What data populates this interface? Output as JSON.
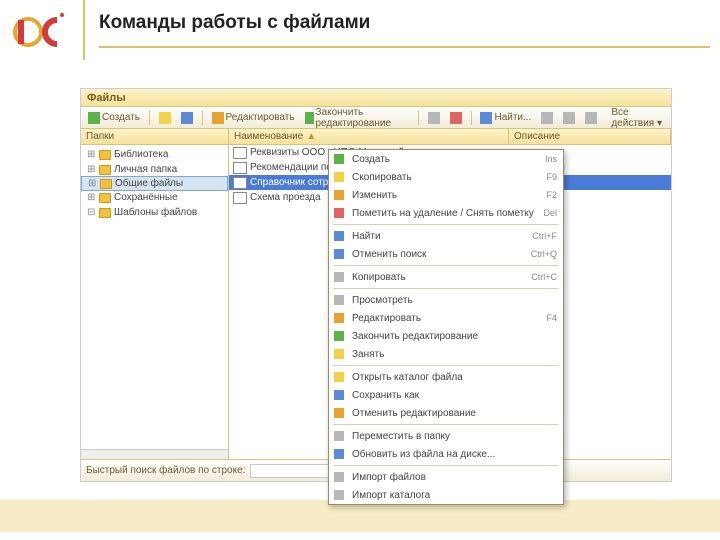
{
  "page_title": "Команды работы с файлами",
  "window_title": "Файлы",
  "toolbar": {
    "create": "Создать",
    "edit": "Редактировать",
    "finish_edit": "Закончить редактирование",
    "find_ellipsis": "Найти...",
    "all_actions": "Все действия ▾"
  },
  "tree": {
    "header": "Папки",
    "items": [
      "Библиотека",
      "Личная папка",
      "Общие файлы",
      "Сохранённые",
      "Шаблоны файлов"
    ]
  },
  "list": {
    "col_name": "Наименование",
    "col_desc": "Описание",
    "rows": [
      "Реквизиты ООО «НПО Меркурий»",
      "Рекомендации по организации дежурства на новогодние праздники",
      "Справочник сотрудников",
      "Схема проезда"
    ]
  },
  "footer": {
    "label": "Быстрый поиск файлов по строке:"
  },
  "context_menu": [
    {
      "icon": "create-icon",
      "label": "Создать",
      "shortcut": "Ins",
      "color": "c-green"
    },
    {
      "icon": "copy-icon",
      "label": "Скопировать",
      "shortcut": "F9",
      "color": "c-yel"
    },
    {
      "icon": "change-icon",
      "label": "Изменить",
      "shortcut": "F2",
      "color": "c-orange"
    },
    {
      "icon": "delete-icon",
      "label": "Пометить на удаление / Снять пометку",
      "shortcut": "Del",
      "color": "c-red"
    },
    {
      "sep": true
    },
    {
      "icon": "find-icon",
      "label": "Найти",
      "shortcut": "Ctrl+F",
      "color": "c-blue"
    },
    {
      "icon": "cancel-find-icon",
      "label": "Отменить поиск",
      "shortcut": "Ctrl+Q",
      "color": "c-blue"
    },
    {
      "sep": true
    },
    {
      "icon": "copy2-icon",
      "label": "Копировать",
      "shortcut": "Ctrl+C",
      "color": "c-grey"
    },
    {
      "sep": true
    },
    {
      "icon": "view-icon",
      "label": "Просмотреть",
      "shortcut": "",
      "color": "c-grey"
    },
    {
      "icon": "edit-icon",
      "label": "Редактировать",
      "shortcut": "F4",
      "color": "c-orange"
    },
    {
      "icon": "finish-edit-icon",
      "label": "Закончить редактирование",
      "shortcut": "",
      "color": "c-green"
    },
    {
      "icon": "take-icon",
      "label": "Занять",
      "shortcut": "",
      "color": "c-yel"
    },
    {
      "sep": true
    },
    {
      "icon": "open-dir-icon",
      "label": "Открыть каталог файла",
      "shortcut": "",
      "color": "c-yel"
    },
    {
      "icon": "saveas-icon",
      "label": "Сохранить как",
      "shortcut": "",
      "color": "c-blue"
    },
    {
      "icon": "release-icon",
      "label": "Отменить редактирование",
      "shortcut": "",
      "color": "c-orange"
    },
    {
      "sep": true
    },
    {
      "icon": "move-icon",
      "label": "Переместить в папку",
      "shortcut": "",
      "color": "c-grey"
    },
    {
      "icon": "update-icon",
      "label": "Обновить из файла на диске...",
      "shortcut": "",
      "color": "c-blue"
    },
    {
      "sep": true
    },
    {
      "icon": "import-files-icon",
      "label": "Импорт файлов",
      "shortcut": "",
      "color": "c-grey"
    },
    {
      "icon": "import-dir-icon",
      "label": "Импорт каталога",
      "shortcut": "",
      "color": "c-grey"
    }
  ]
}
